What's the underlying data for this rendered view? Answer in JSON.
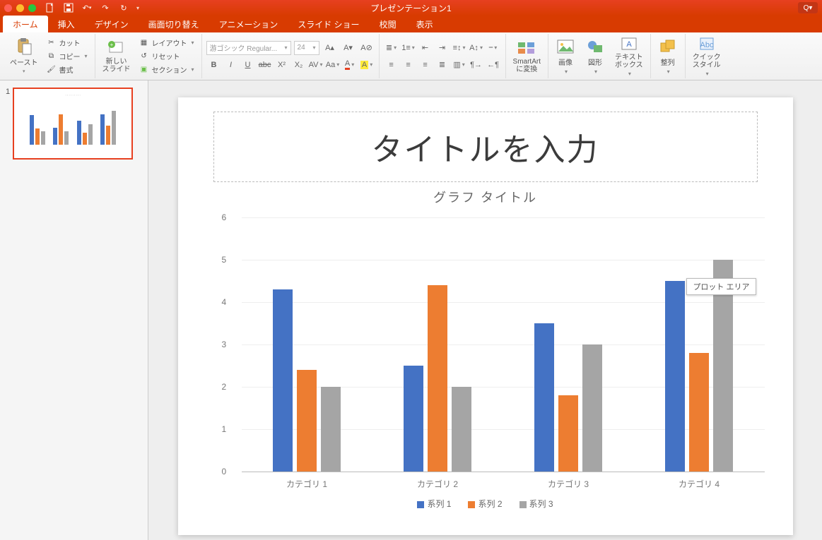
{
  "window": {
    "title": "プレゼンテーション1"
  },
  "qat": {
    "items": [
      "file",
      "save",
      "undo",
      "redo",
      "repeat"
    ]
  },
  "tabs": [
    {
      "id": "home",
      "label": "ホーム",
      "active": true
    },
    {
      "id": "insert",
      "label": "挿入"
    },
    {
      "id": "design",
      "label": "デザイン"
    },
    {
      "id": "transitions",
      "label": "画面切り替え"
    },
    {
      "id": "animations",
      "label": "アニメーション"
    },
    {
      "id": "slideshow",
      "label": "スライド ショー"
    },
    {
      "id": "review",
      "label": "校閲"
    },
    {
      "id": "view",
      "label": "表示"
    }
  ],
  "ribbon": {
    "paste": "ペースト",
    "cut": "カット",
    "copy": "コピー",
    "format": "書式",
    "new_slide": "新しい\nスライド",
    "layout": "レイアウト",
    "reset": "リセット",
    "section": "セクション",
    "font_name": "游ゴシック Regular...",
    "font_size": "24",
    "smartart": "SmartArt\nに変換",
    "picture": "画像",
    "shapes": "図形",
    "textbox": "テキスト\nボックス",
    "arrange": "整列",
    "quickstyles": "クイック\nスタイル"
  },
  "thumb": {
    "number": "1"
  },
  "slide": {
    "title_placeholder": "タイトルを入力",
    "chart_title": "グラフ タイトル",
    "tooltip": "プロット エリア"
  },
  "chart_data": {
    "type": "bar",
    "title": "グラフ タイトル",
    "xlabel": "",
    "ylabel": "",
    "ylim": [
      0,
      6
    ],
    "yticks": [
      0,
      1,
      2,
      3,
      4,
      5,
      6
    ],
    "categories": [
      "カテゴリ 1",
      "カテゴリ 2",
      "カテゴリ 3",
      "カテゴリ 4"
    ],
    "series": [
      {
        "name": "系列 1",
        "color": "#4472C4",
        "values": [
          4.3,
          2.5,
          3.5,
          4.5
        ]
      },
      {
        "name": "系列 2",
        "color": "#ED7D31",
        "values": [
          2.4,
          4.4,
          1.8,
          2.8
        ]
      },
      {
        "name": "系列 3",
        "color": "#A5A5A5",
        "values": [
          2.0,
          2.0,
          3.0,
          5.0
        ]
      }
    ]
  }
}
